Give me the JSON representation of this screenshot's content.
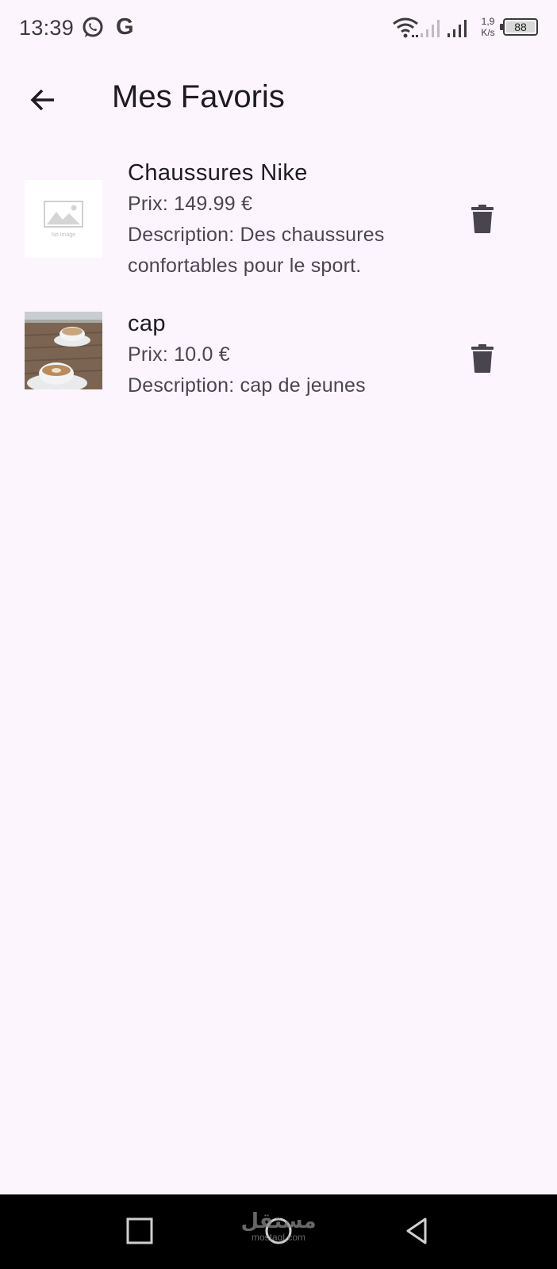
{
  "status_bar": {
    "time": "13:39",
    "g_label": "G",
    "net_speed_value": "1,9",
    "net_speed_unit": "K/s",
    "battery": "88"
  },
  "app_bar": {
    "title": "Mes Favoris",
    "back_icon": "arrow-back-icon"
  },
  "favorites": [
    {
      "name": "Chaussures Nike",
      "price": "Prix: 149.99 €",
      "description": "Description: Des chaussures confortables pour le sport.",
      "image": "no-image-placeholder",
      "placeholder_caption": "No Image"
    },
    {
      "name": "cap",
      "price": "Prix: 10.0 €",
      "description": "Description: cap de jeunes",
      "image": "coffee-cups-photo"
    }
  ],
  "nav_bar": {
    "recent_icon": "square-icon",
    "home_icon": "circle-icon",
    "back_icon": "triangle-back-icon"
  },
  "watermark": {
    "arabic": "مستقل",
    "latin": "mostaql.com"
  },
  "colors": {
    "background": "#fcf5fd",
    "text_primary": "#1d1b20",
    "text_secondary": "#4a4650",
    "icon": "#49454f",
    "nav_bar": "#000000"
  }
}
